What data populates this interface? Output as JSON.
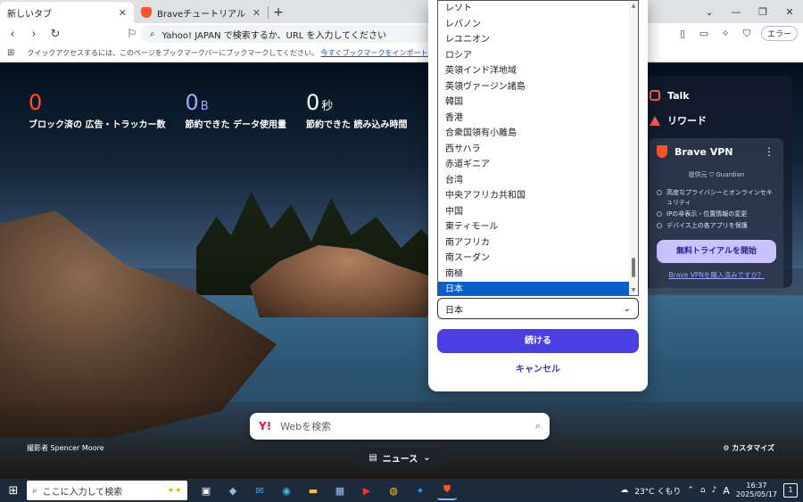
{
  "tabs": [
    {
      "label": "新しいタブ",
      "close": "✕"
    },
    {
      "label": "Braveチュートリアル for Desktop | Brav",
      "close": "✕"
    }
  ],
  "newtab_symbol": "+",
  "window_controls": [
    "⌄",
    "—",
    "❐",
    "✕"
  ],
  "toolbar": {
    "omnibox_placeholder": "Yahoo! JAPAN で検索するか、URL を入力してください",
    "profile_label": "エラー"
  },
  "bookmarks": {
    "message": "クイックアクセスするには、このページをブックマークバーにブックマークしてください。",
    "import_link": "今すぐブックマークをインポート..."
  },
  "stats": [
    {
      "value": "0",
      "unit": "",
      "desc": "ブロック済の 広告・トラッカー数"
    },
    {
      "value": "0",
      "unit": "B",
      "desc": "節約できた データ使用量"
    },
    {
      "value": "0",
      "unit": "秒",
      "desc": "節約できた 読み込み時間"
    }
  ],
  "widget": {
    "talk": "Talk",
    "rewards": "リワード",
    "vpn": {
      "title": "Brave VPN",
      "menu": "⋮",
      "provided_by": "提供元",
      "provider": "Guardian",
      "features": [
        "高度なプライバシーとオンラインセキュリティ",
        "IPの非表示・位置情報の変更",
        "デバイス上の各アプリを保護"
      ],
      "trial_button": "無料トライアルを開始",
      "purchased_link": "Brave VPNを購入済みですか？"
    }
  },
  "dropdown": {
    "options": [
      "レソト",
      "レバノン",
      "レユニオン",
      "ロシア",
      "英領インド洋地域",
      "英領ヴァージン諸島",
      "韓国",
      "香港",
      "合衆国領有小離島",
      "西サハラ",
      "赤道ギニア",
      "台湾",
      "中央アフリカ共和国",
      "中国",
      "東ティモール",
      "南アフリカ",
      "南スーダン",
      "南極",
      "日本"
    ],
    "selected": "日本",
    "selected_index": 18
  },
  "dialog": {
    "continue": "続ける",
    "cancel": "キャンセル"
  },
  "search": {
    "engine_logo": "Y!",
    "placeholder": "Webを検索"
  },
  "photo_credit": "撮影者 Spencer Moore",
  "customize": "カスタマイズ",
  "news": "ニュース",
  "taskbar": {
    "search_placeholder": "ここに入力して検索",
    "weather": "23°C くもり",
    "ime": "A",
    "time": "16:37",
    "date": "2025/05/17",
    "notifications": "1"
  }
}
